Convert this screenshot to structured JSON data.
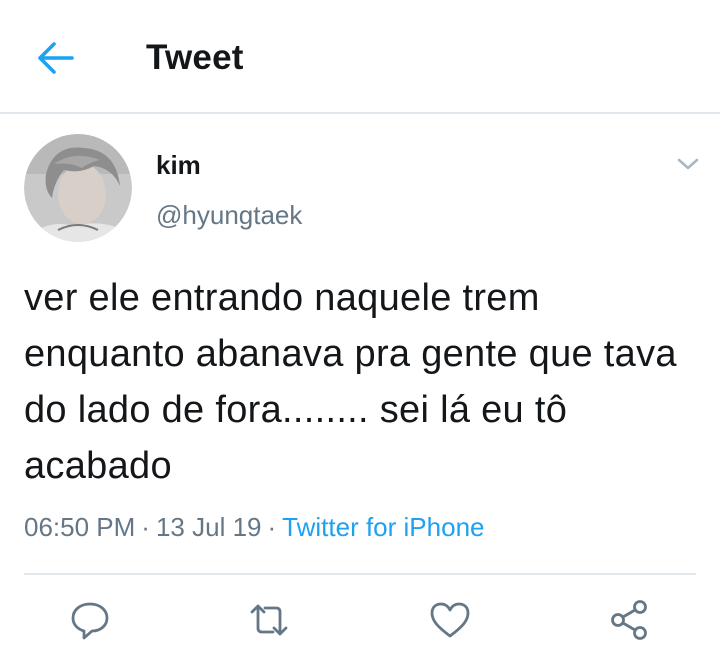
{
  "header": {
    "title": "Tweet",
    "back_icon": "arrow-left-icon",
    "accent_color": "#1da1f2"
  },
  "tweet": {
    "author_name": "kim",
    "author_handle": "@hyungtaek",
    "text": "ver ele entrando naquele trem enquanto abanava pra gente que tava do lado de fora........ sei lá eu tô acabado",
    "time": "06:50 PM",
    "date": "13 Jul 19",
    "source": "Twitter for iPhone",
    "separator": "·",
    "menu_icon": "chevron-down-icon"
  },
  "actions": [
    {
      "icon": "reply-icon"
    },
    {
      "icon": "retweet-icon"
    },
    {
      "icon": "like-icon"
    },
    {
      "icon": "share-icon"
    }
  ],
  "colors": {
    "text": "#14171a",
    "secondary": "#657786",
    "link": "#1da1f2",
    "divider": "#e1e8ed"
  }
}
